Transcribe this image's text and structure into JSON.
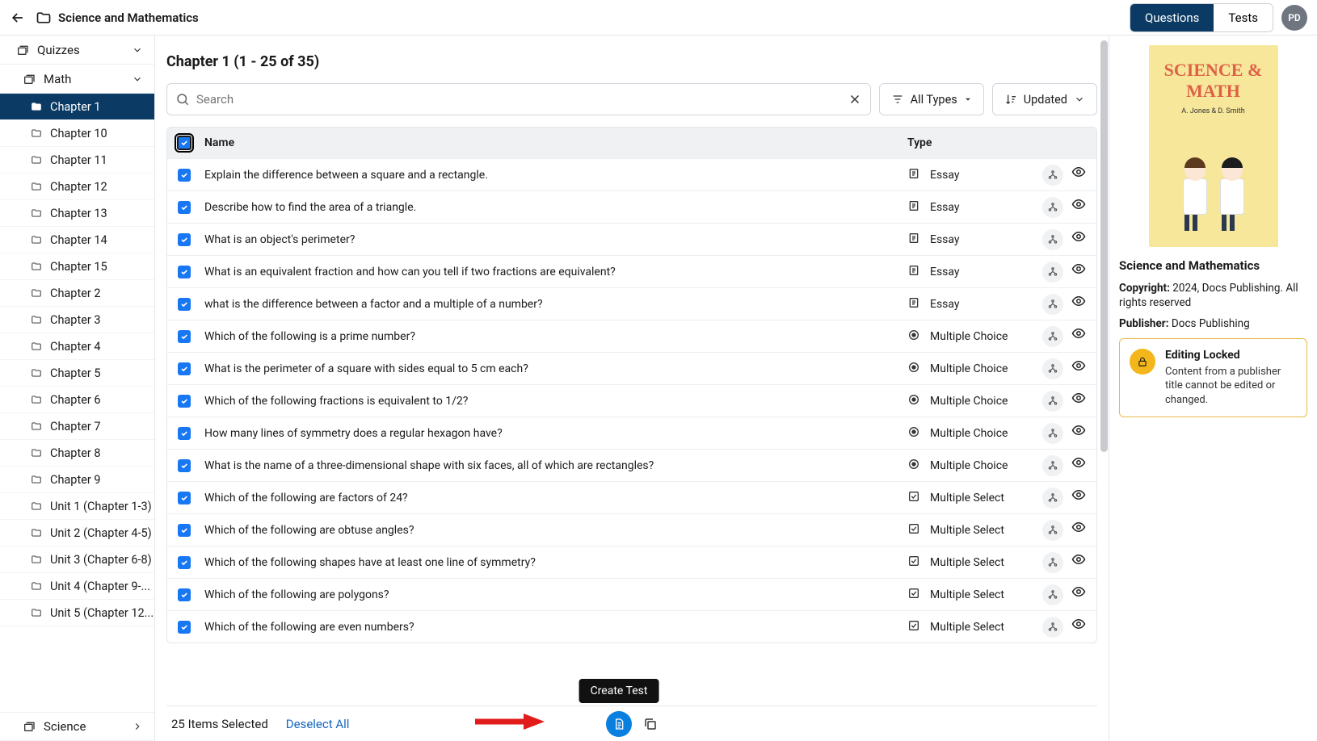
{
  "header": {
    "breadcrumb_title": "Science and Mathematics",
    "tab_questions": "Questions",
    "tab_tests": "Tests",
    "avatar_initials": "PD"
  },
  "sidebar": {
    "group_quizzes": "Quizzes",
    "group_math": "Math",
    "group_science": "Science",
    "items": [
      {
        "label": "Chapter 1",
        "selected": true
      },
      {
        "label": "Chapter 10"
      },
      {
        "label": "Chapter 11"
      },
      {
        "label": "Chapter 12"
      },
      {
        "label": "Chapter 13"
      },
      {
        "label": "Chapter 14"
      },
      {
        "label": "Chapter 15"
      },
      {
        "label": "Chapter 2"
      },
      {
        "label": "Chapter 3"
      },
      {
        "label": "Chapter 4"
      },
      {
        "label": "Chapter 5"
      },
      {
        "label": "Chapter 6"
      },
      {
        "label": "Chapter 7"
      },
      {
        "label": "Chapter 8"
      },
      {
        "label": "Chapter 9"
      },
      {
        "label": "Unit 1 (Chapter 1-3)"
      },
      {
        "label": "Unit 2 (Chapter 4-5)"
      },
      {
        "label": "Unit 3 (Chapter 6-8)"
      },
      {
        "label": "Unit 4 (Chapter 9-..."
      },
      {
        "label": "Unit 5 (Chapter 12..."
      }
    ]
  },
  "main": {
    "title": "Chapter 1 (1 - 25 of 35)",
    "search_placeholder": "Search",
    "filter_types": "All Types",
    "sort_label": "Updated",
    "col_name": "Name",
    "col_type": "Type"
  },
  "rows": [
    {
      "name": "Explain the difference between a square and a rectangle.",
      "type": "Essay",
      "icon": "essay"
    },
    {
      "name": "Describe how to find the area of a triangle.",
      "type": "Essay",
      "icon": "essay"
    },
    {
      "name": "What is an object's perimeter?",
      "type": "Essay",
      "icon": "essay"
    },
    {
      "name": "What is an equivalent fraction and how can you tell if two fractions are equivalent?",
      "type": "Essay",
      "icon": "essay"
    },
    {
      "name": "what is the difference between a factor and a multiple of a number?",
      "type": "Essay",
      "icon": "essay"
    },
    {
      "name": "Which of the following is a prime number?",
      "type": "Multiple Choice",
      "icon": "mc"
    },
    {
      "name": "What is the perimeter of a square with sides equal to 5 cm each?",
      "type": "Multiple Choice",
      "icon": "mc"
    },
    {
      "name": "Which of the following fractions is equivalent to 1/2?",
      "type": "Multiple Choice",
      "icon": "mc"
    },
    {
      "name": "How many lines of symmetry does a regular hexagon have?",
      "type": "Multiple Choice",
      "icon": "mc"
    },
    {
      "name": "What is the name of a three-dimensional shape with six faces, all of which are rectangles?",
      "type": "Multiple Choice",
      "icon": "mc"
    },
    {
      "name": "Which of the following are factors of 24?",
      "type": "Multiple Select",
      "icon": "ms"
    },
    {
      "name": "Which of the following are obtuse angles?",
      "type": "Multiple Select",
      "icon": "ms"
    },
    {
      "name": "Which of the following shapes have at least one line of symmetry?",
      "type": "Multiple Select",
      "icon": "ms"
    },
    {
      "name": "Which of the following are polygons?",
      "type": "Multiple Select",
      "icon": "ms"
    },
    {
      "name": "Which of the following are even numbers?",
      "type": "Multiple Select",
      "icon": "ms"
    }
  ],
  "footer": {
    "selected_text": "25 Items Selected",
    "deselect": "Deselect All",
    "tooltip": "Create Test"
  },
  "rpanel": {
    "cover_title": "SCIENCE & MATH",
    "cover_authors": "A. Jones & D. Smith",
    "title": "Science and Mathematics",
    "copyright_label": "Copyright:",
    "copyright_value": "2024, Docs Publishing. All rights reserved",
    "publisher_label": "Publisher:",
    "publisher_value": "Docs Publishing",
    "lock_title": "Editing Locked",
    "lock_desc": "Content from a publisher title cannot be edited or changed."
  }
}
